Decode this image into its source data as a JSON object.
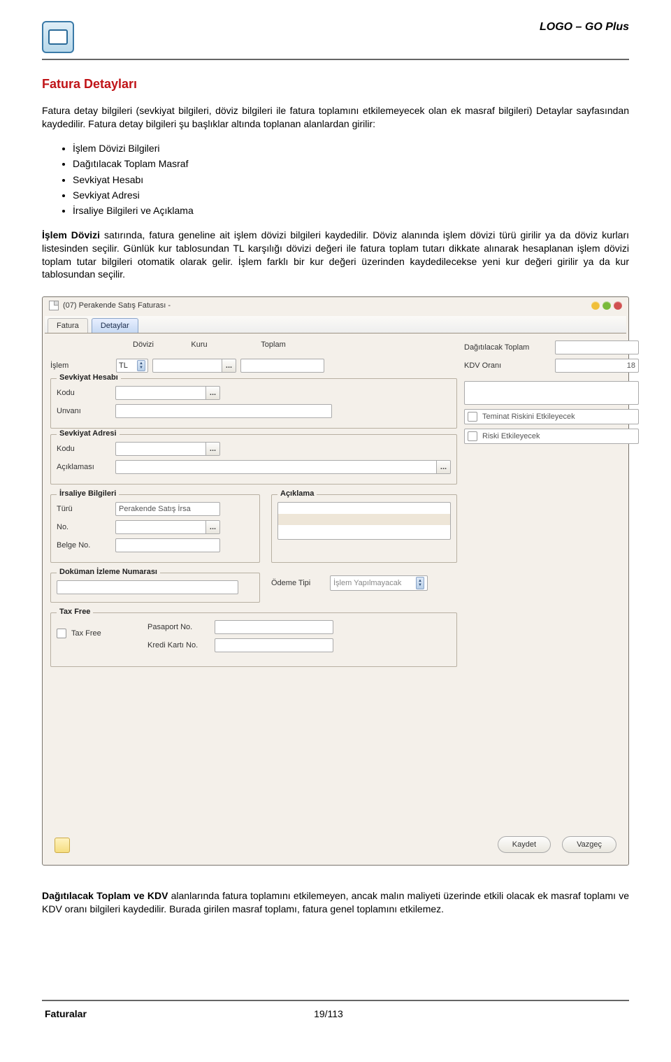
{
  "header": {
    "brand": "LOGO – GO Plus"
  },
  "section_title": "Fatura Detayları",
  "paragraphs": {
    "p1": "Fatura detay bilgileri (sevkiyat bilgileri, döviz bilgileri ile fatura toplamını etkilemeyecek olan ek masraf bilgileri) Detaylar sayfasından kaydedilir. Fatura detay bilgileri şu başlıklar altında toplanan alanlardan girilir:",
    "p2_lead": "İşlem Dövizi",
    "p2_rest": " satırında, fatura geneline ait işlem dövizi bilgileri kaydedilir. Döviz alanında işlem dövizi türü girilir ya da döviz kurları listesinden seçilir. Günlük kur tablosundan TL karşılığı dövizi değeri ile fatura toplam tutarı dikkate alınarak hesaplanan işlem dövizi toplam tutar bilgileri otomatik olarak gelir. İşlem farklı bir kur değeri üzerinden kaydedilecekse yeni kur değeri girilir ya da kur tablosundan seçilir.",
    "p3_lead": "Dağıtılacak Toplam ve KDV",
    "p3_rest": " alanlarında fatura toplamını etkilemeyen, ancak malın maliyeti üzerinde etkili olacak ek masraf toplamı ve KDV oranı bilgileri kaydedilir. Burada girilen masraf toplamı, fatura genel toplamını etkilemez."
  },
  "bullets": [
    "İşlem Dövizi Bilgileri",
    "Dağıtılacak Toplam Masraf",
    "Sevkiyat Hesabı",
    "Sevkiyat Adresi",
    "İrsaliye Bilgileri ve Açıklama"
  ],
  "window": {
    "title": "(07) Perakende Satış Faturası -",
    "tabs": [
      "Fatura",
      "Detaylar"
    ],
    "col_headers": [
      "Dövizi",
      "Kuru",
      "Toplam"
    ],
    "islem_label": "İşlem",
    "islem_value": "TL",
    "dagitilacak_label": "Dağıtılacak Toplam",
    "kdv_label": "KDV Oranı",
    "kdv_value": "18",
    "teminat_label": "Teminat Riskini Etkileyecek",
    "riski_label": "Riski Etkileyecek",
    "groups": {
      "sevkiyat_hesabi": {
        "title": "Sevkiyat Hesabı",
        "kodu": "Kodu",
        "unvani": "Unvanı"
      },
      "sevkiyat_adresi": {
        "title": "Sevkiyat Adresi",
        "kodu": "Kodu",
        "aciklamasi": "Açıklaması"
      },
      "irsaliye": {
        "title": "İrsaliye Bilgileri",
        "turu": "Türü",
        "turu_val": "Perakende Satış İrsa",
        "no": "No.",
        "belge_no": "Belge No."
      },
      "aciklama": {
        "title": "Açıklama"
      },
      "dokuman": {
        "title": "Doküman İzleme Numarası"
      },
      "tax_free": {
        "title": "Tax Free",
        "cb": "Tax Free",
        "pasaport": "Pasaport No.",
        "kredi": "Kredi Kartı No."
      }
    },
    "odeme_label": "Ödeme Tipi",
    "odeme_value": "İşlem Yapılmayacak",
    "buttons": {
      "save": "Kaydet",
      "cancel": "Vazgeç"
    }
  },
  "footer": {
    "left": "Faturalar",
    "page": "19/113"
  }
}
